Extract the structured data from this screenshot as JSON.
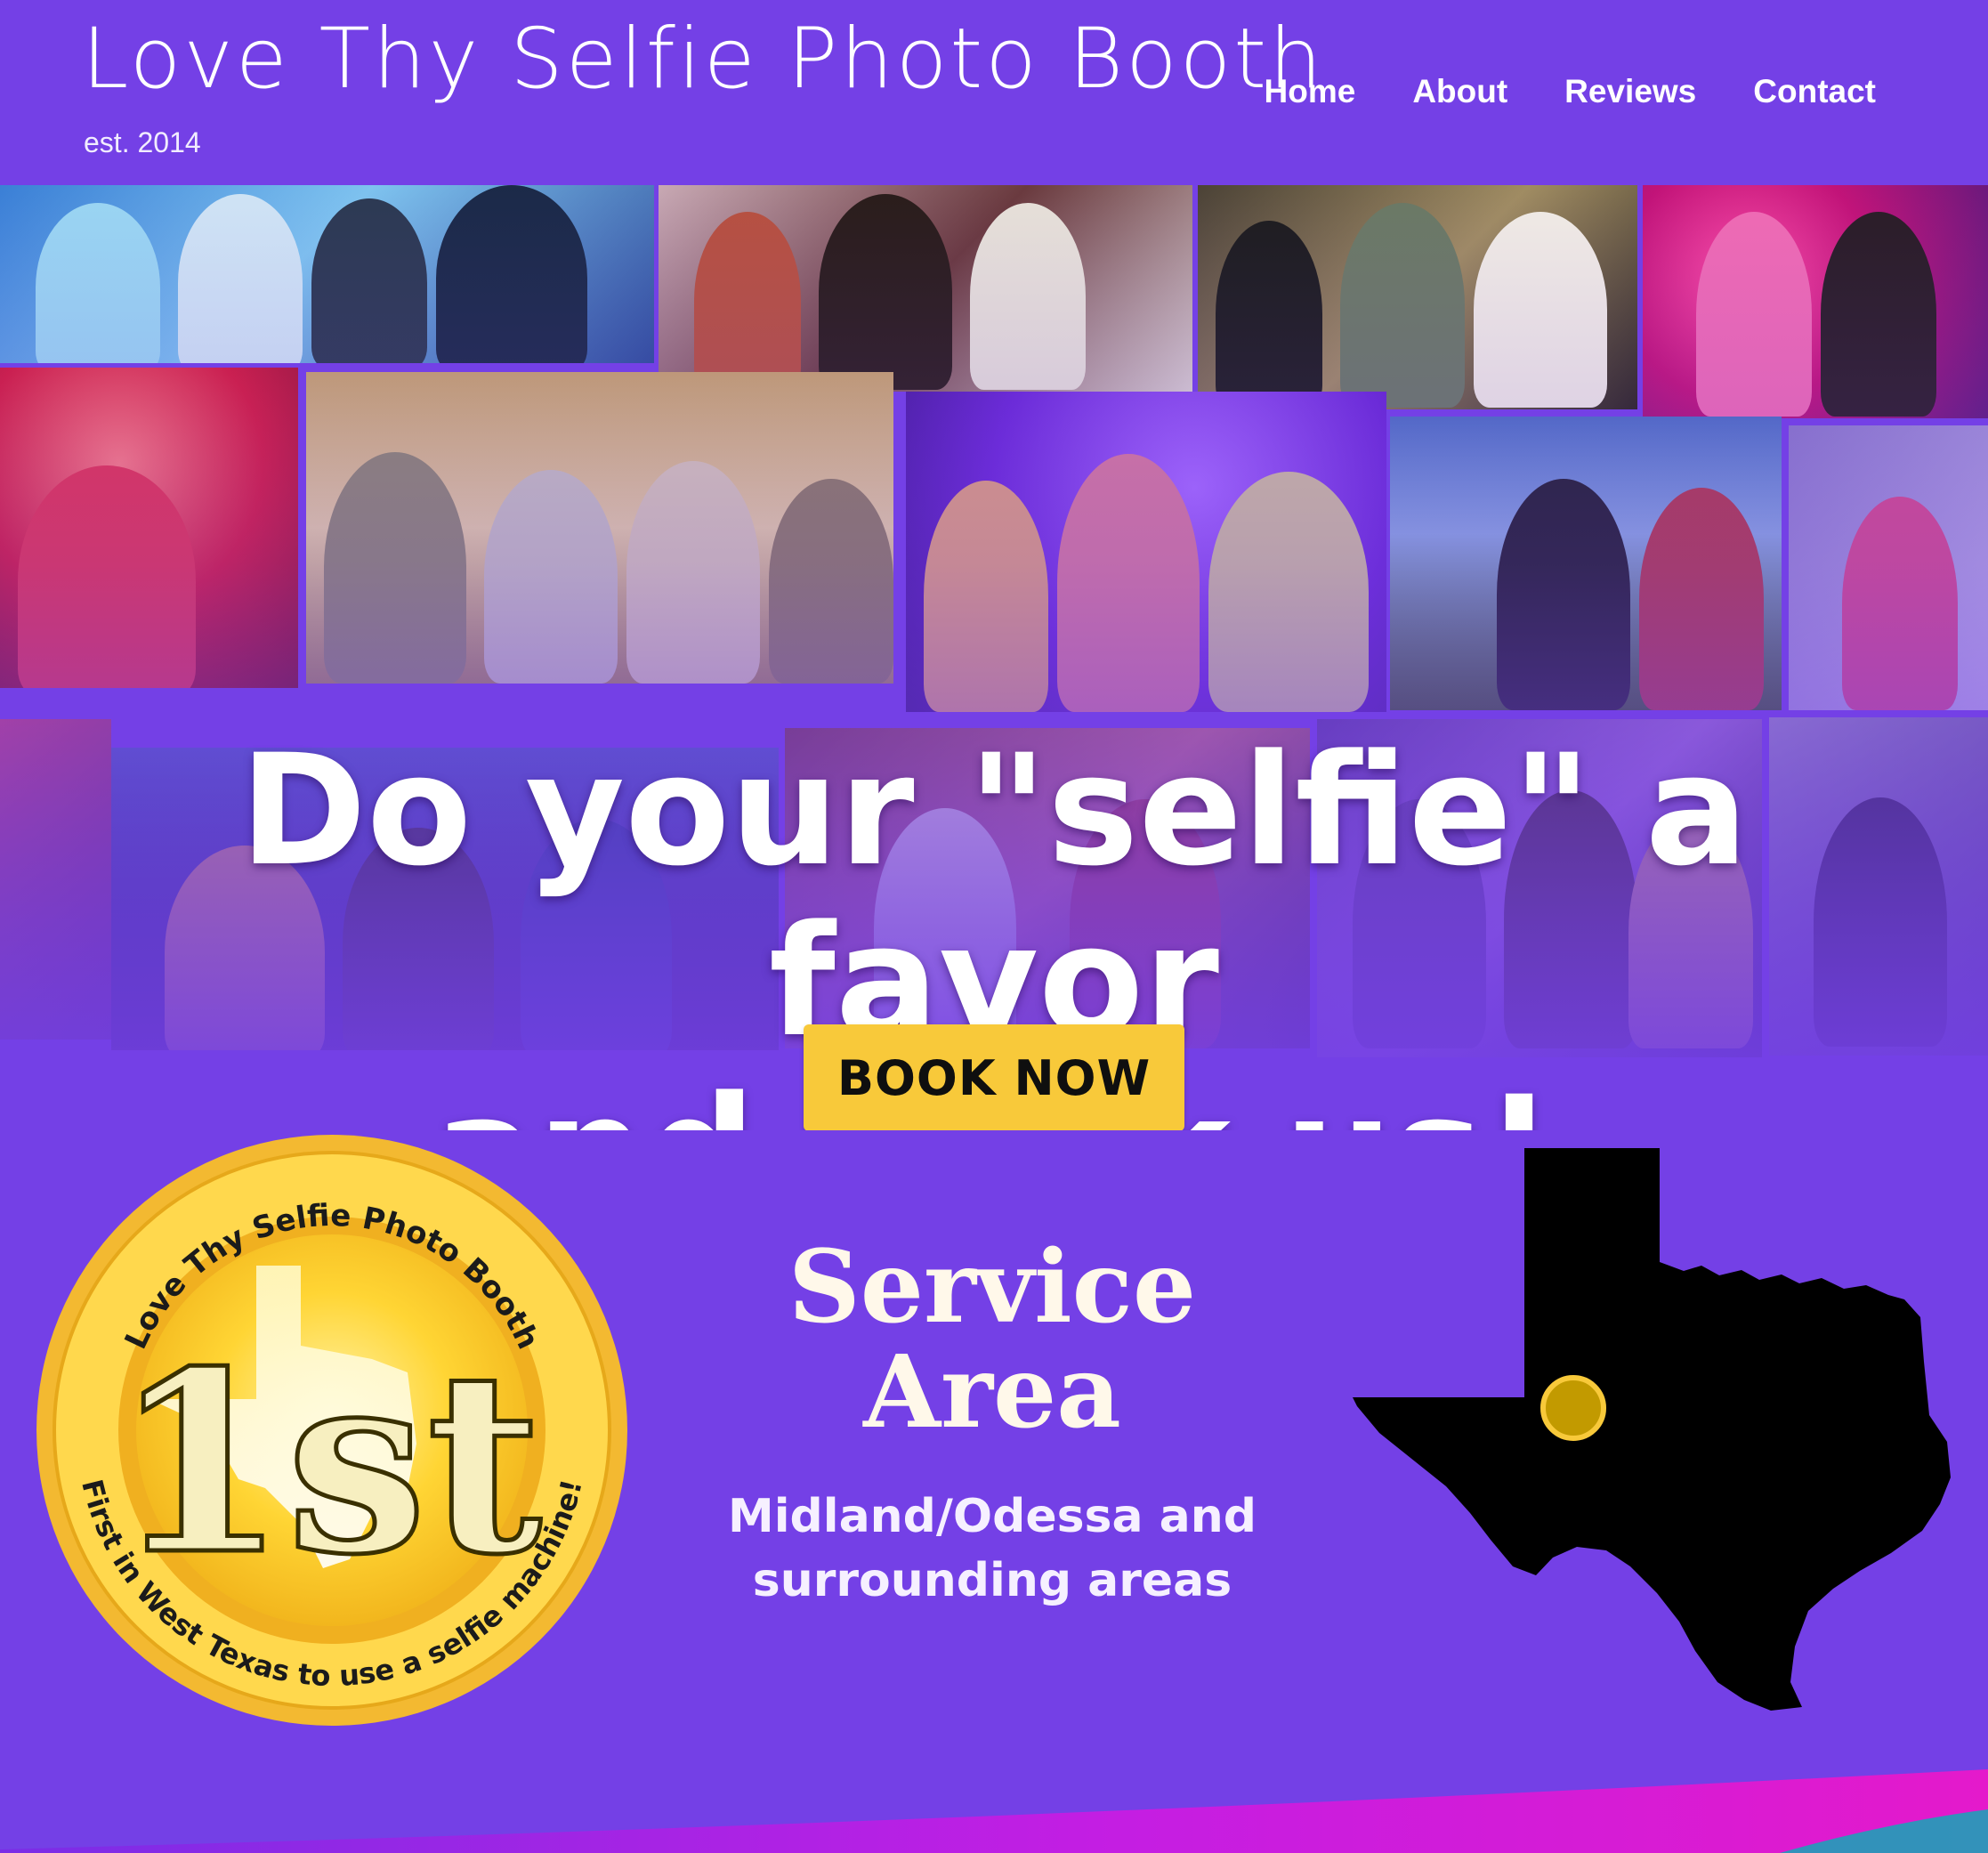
{
  "header": {
    "title": "Love Thy Selfie Photo Booth",
    "subtitle": "est. 2014",
    "nav": [
      {
        "label": "Home"
      },
      {
        "label": "About"
      },
      {
        "label": "Reviews"
      },
      {
        "label": "Contact"
      }
    ]
  },
  "hero": {
    "headline_line1": "Do your \"selfie\" a favor",
    "headline_line2": "and book us!",
    "cta_label": "BOOK NOW"
  },
  "badge": {
    "top_arc_text": "Love Thy Selfie Photo Booth",
    "bottom_arc_text": "First in West Texas to use a selfie machine!",
    "center_text": "1st"
  },
  "service_area": {
    "title_line1": "Service",
    "title_line2": "Area",
    "subtitle_line1": "Midland/Odessa and",
    "subtitle_line2": "surrounding areas"
  },
  "colors": {
    "brand_purple": "#7440e6",
    "cta_yellow": "#f8c93a",
    "badge_gold": "#f3b931",
    "map_black": "#000000",
    "marker_gold": "#c29a00",
    "wave_magenta": "#d81be0"
  }
}
